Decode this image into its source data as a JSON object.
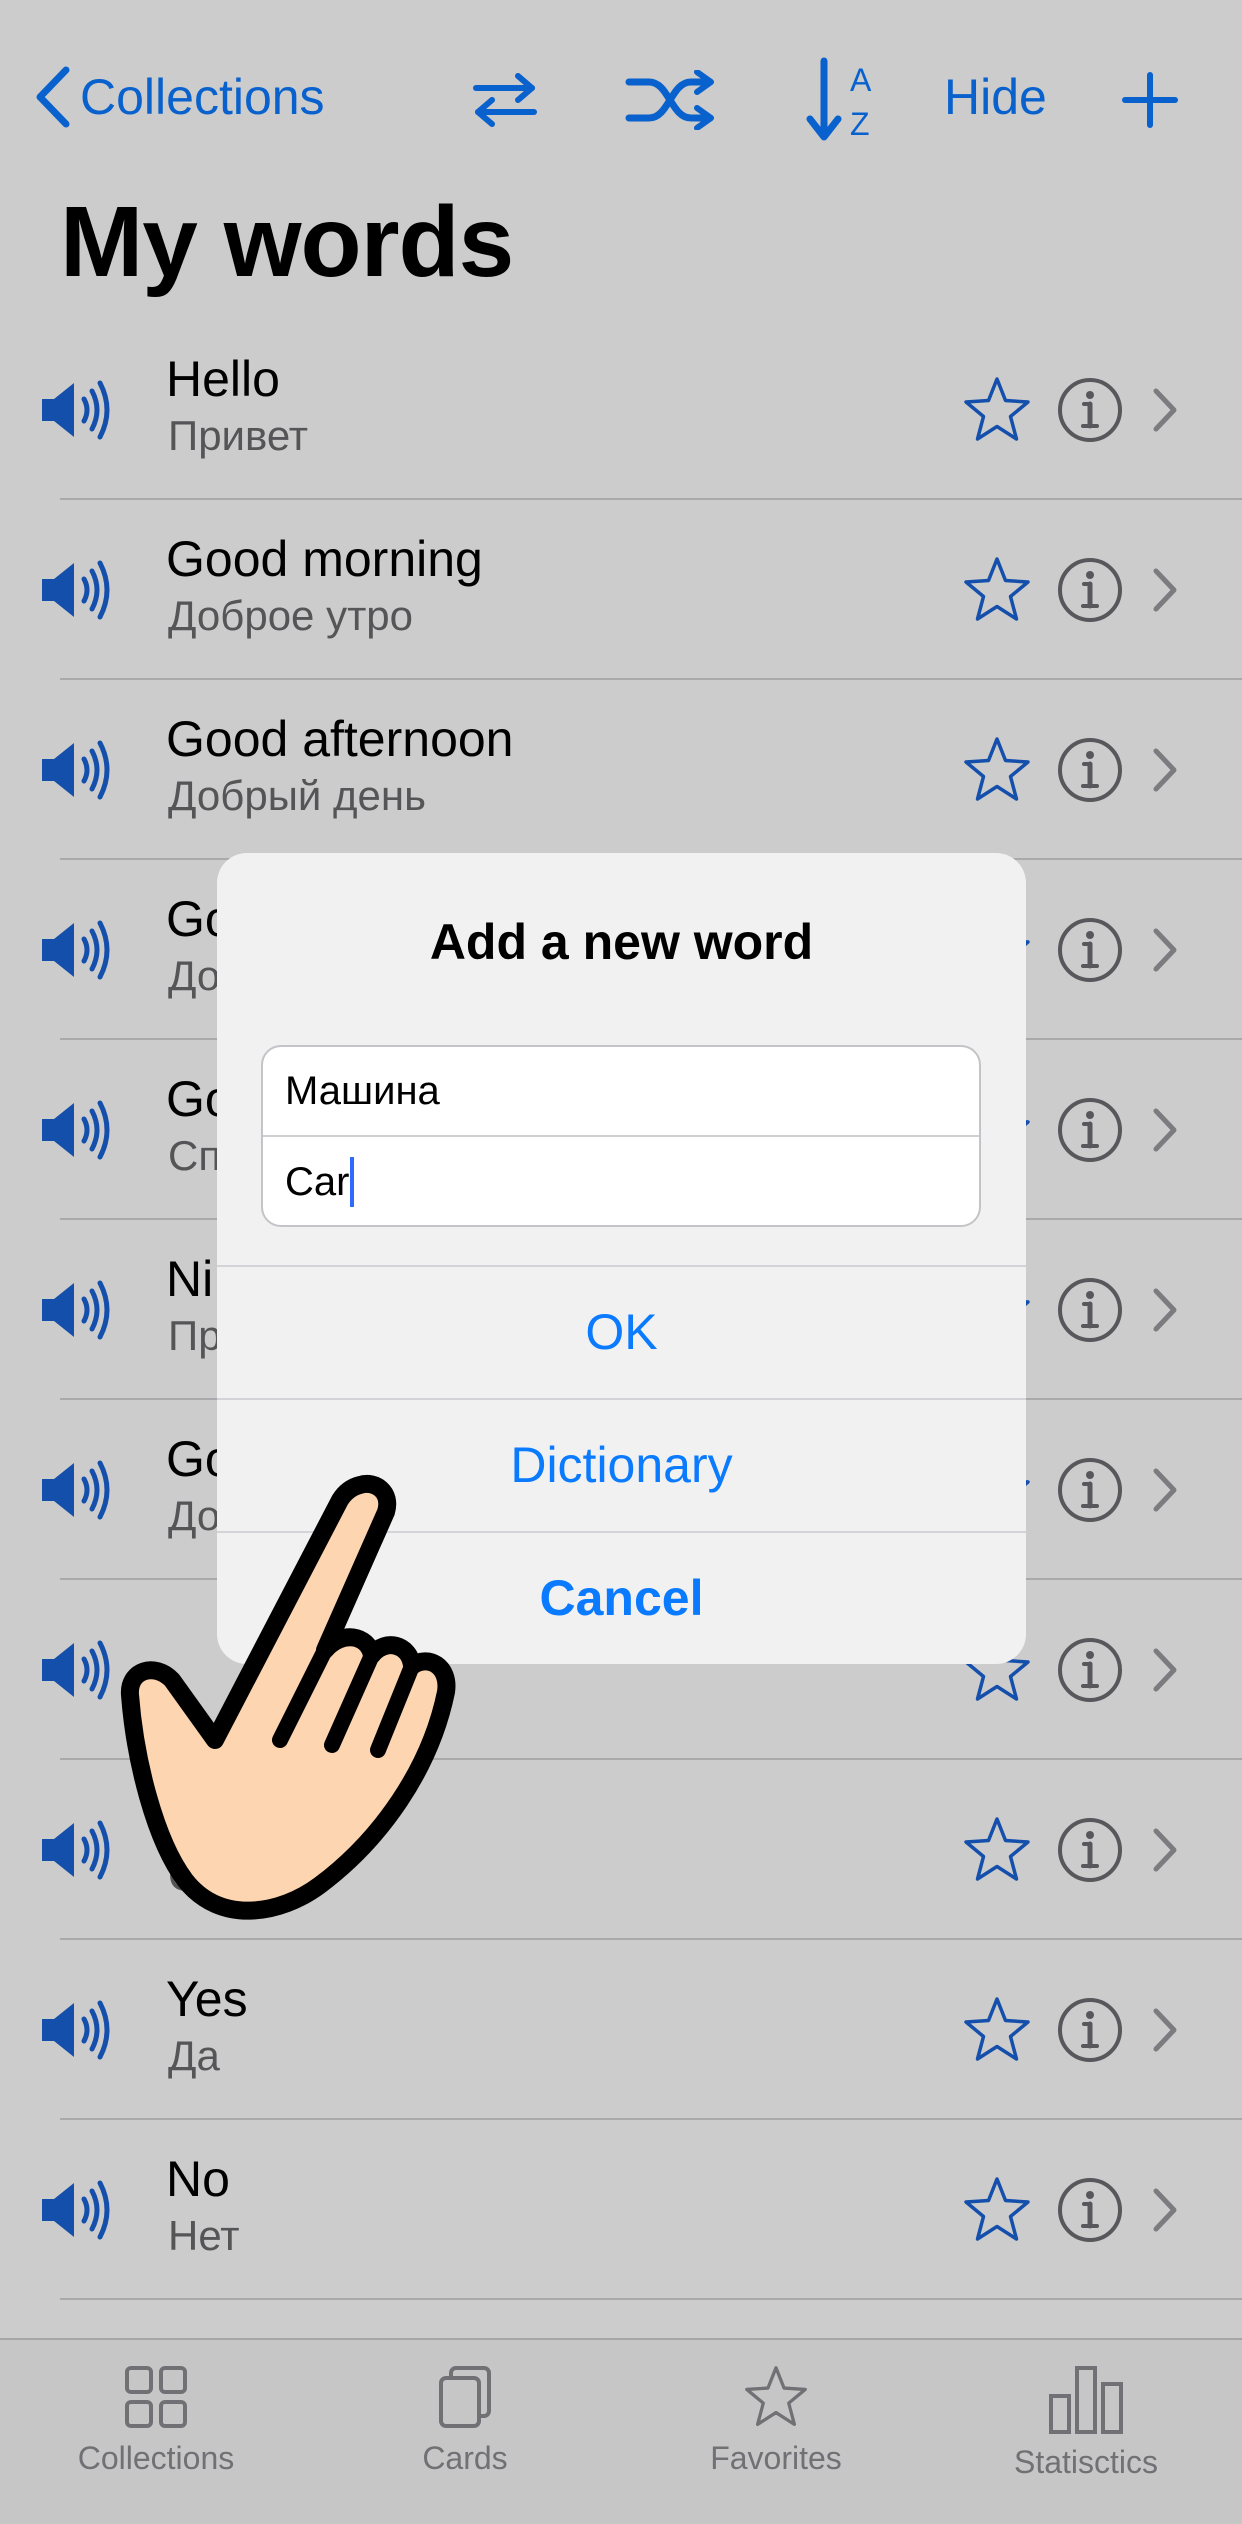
{
  "nav": {
    "back_label": "Collections",
    "swap_icon": "swap-arrows-icon",
    "shuffle_icon": "shuffle-icon",
    "sort_icon": "sort-az-icon",
    "hide_label": "Hide",
    "add_icon": "plus-icon"
  },
  "title": "My words",
  "words": [
    {
      "word": "Hello",
      "translation": "Привет"
    },
    {
      "word": "Good morning",
      "translation": "Доброе утро"
    },
    {
      "word": "Good afternoon",
      "translation": "Добрый день"
    },
    {
      "word": "Go",
      "translation": "До"
    },
    {
      "word": "Go",
      "translation": "Сп"
    },
    {
      "word": "Ni",
      "translation": "Пр"
    },
    {
      "word": "Go",
      "translation": "До"
    },
    {
      "word": "",
      "translation": ""
    },
    {
      "word": "",
      "translation": "С"
    },
    {
      "word": "Yes",
      "translation": "Да"
    },
    {
      "word": "No",
      "translation": "Нет"
    }
  ],
  "dialog": {
    "title": "Add a new word",
    "field1_value": "Машина",
    "field2_value": "Car",
    "ok_label": "OK",
    "dictionary_label": "Dictionary",
    "cancel_label": "Cancel"
  },
  "tabbar": {
    "tabs": [
      {
        "label": "Collections",
        "icon": "grid-icon"
      },
      {
        "label": "Cards",
        "icon": "cards-icon"
      },
      {
        "label": "Favorites",
        "icon": "star-icon"
      },
      {
        "label": "Statisctics",
        "icon": "bar-chart-icon"
      }
    ]
  },
  "colors": {
    "accent": "#0a7aff",
    "speaker_blue": "#1a63d8",
    "dim_overlay": "rgba(0,0,0,0.2)",
    "hand_skin": "#fdd5b0"
  }
}
